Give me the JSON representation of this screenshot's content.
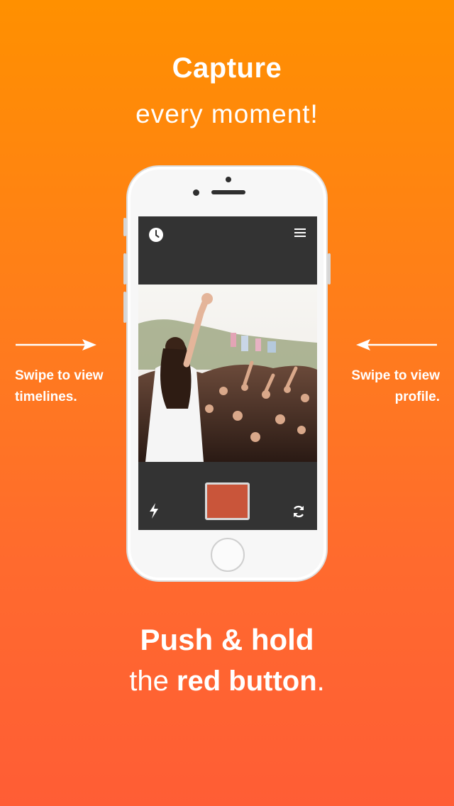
{
  "headline": {
    "line1": "Capture",
    "line2": "every moment!"
  },
  "side_hints": {
    "left": {
      "line1": "Swipe to view",
      "line2": "timelines."
    },
    "right": {
      "line1": "Swipe to view",
      "line2": "profile."
    }
  },
  "app_screen": {
    "top_left_icon": "clock-icon",
    "top_right_icon": "menu-icon",
    "photo_content": "concert-crowd-photo",
    "bottom_left_icon": "flash-icon",
    "bottom_right_icon": "flip-camera-icon",
    "record_button_color": "#c9553a"
  },
  "footer": {
    "line1": "Push & hold",
    "line2_part1": "the ",
    "line2_part2": "red button",
    "line2_part3": "."
  },
  "colors": {
    "gradient_top": "#ff9000",
    "gradient_bottom": "#ff5d35",
    "app_bar": "#333333"
  }
}
